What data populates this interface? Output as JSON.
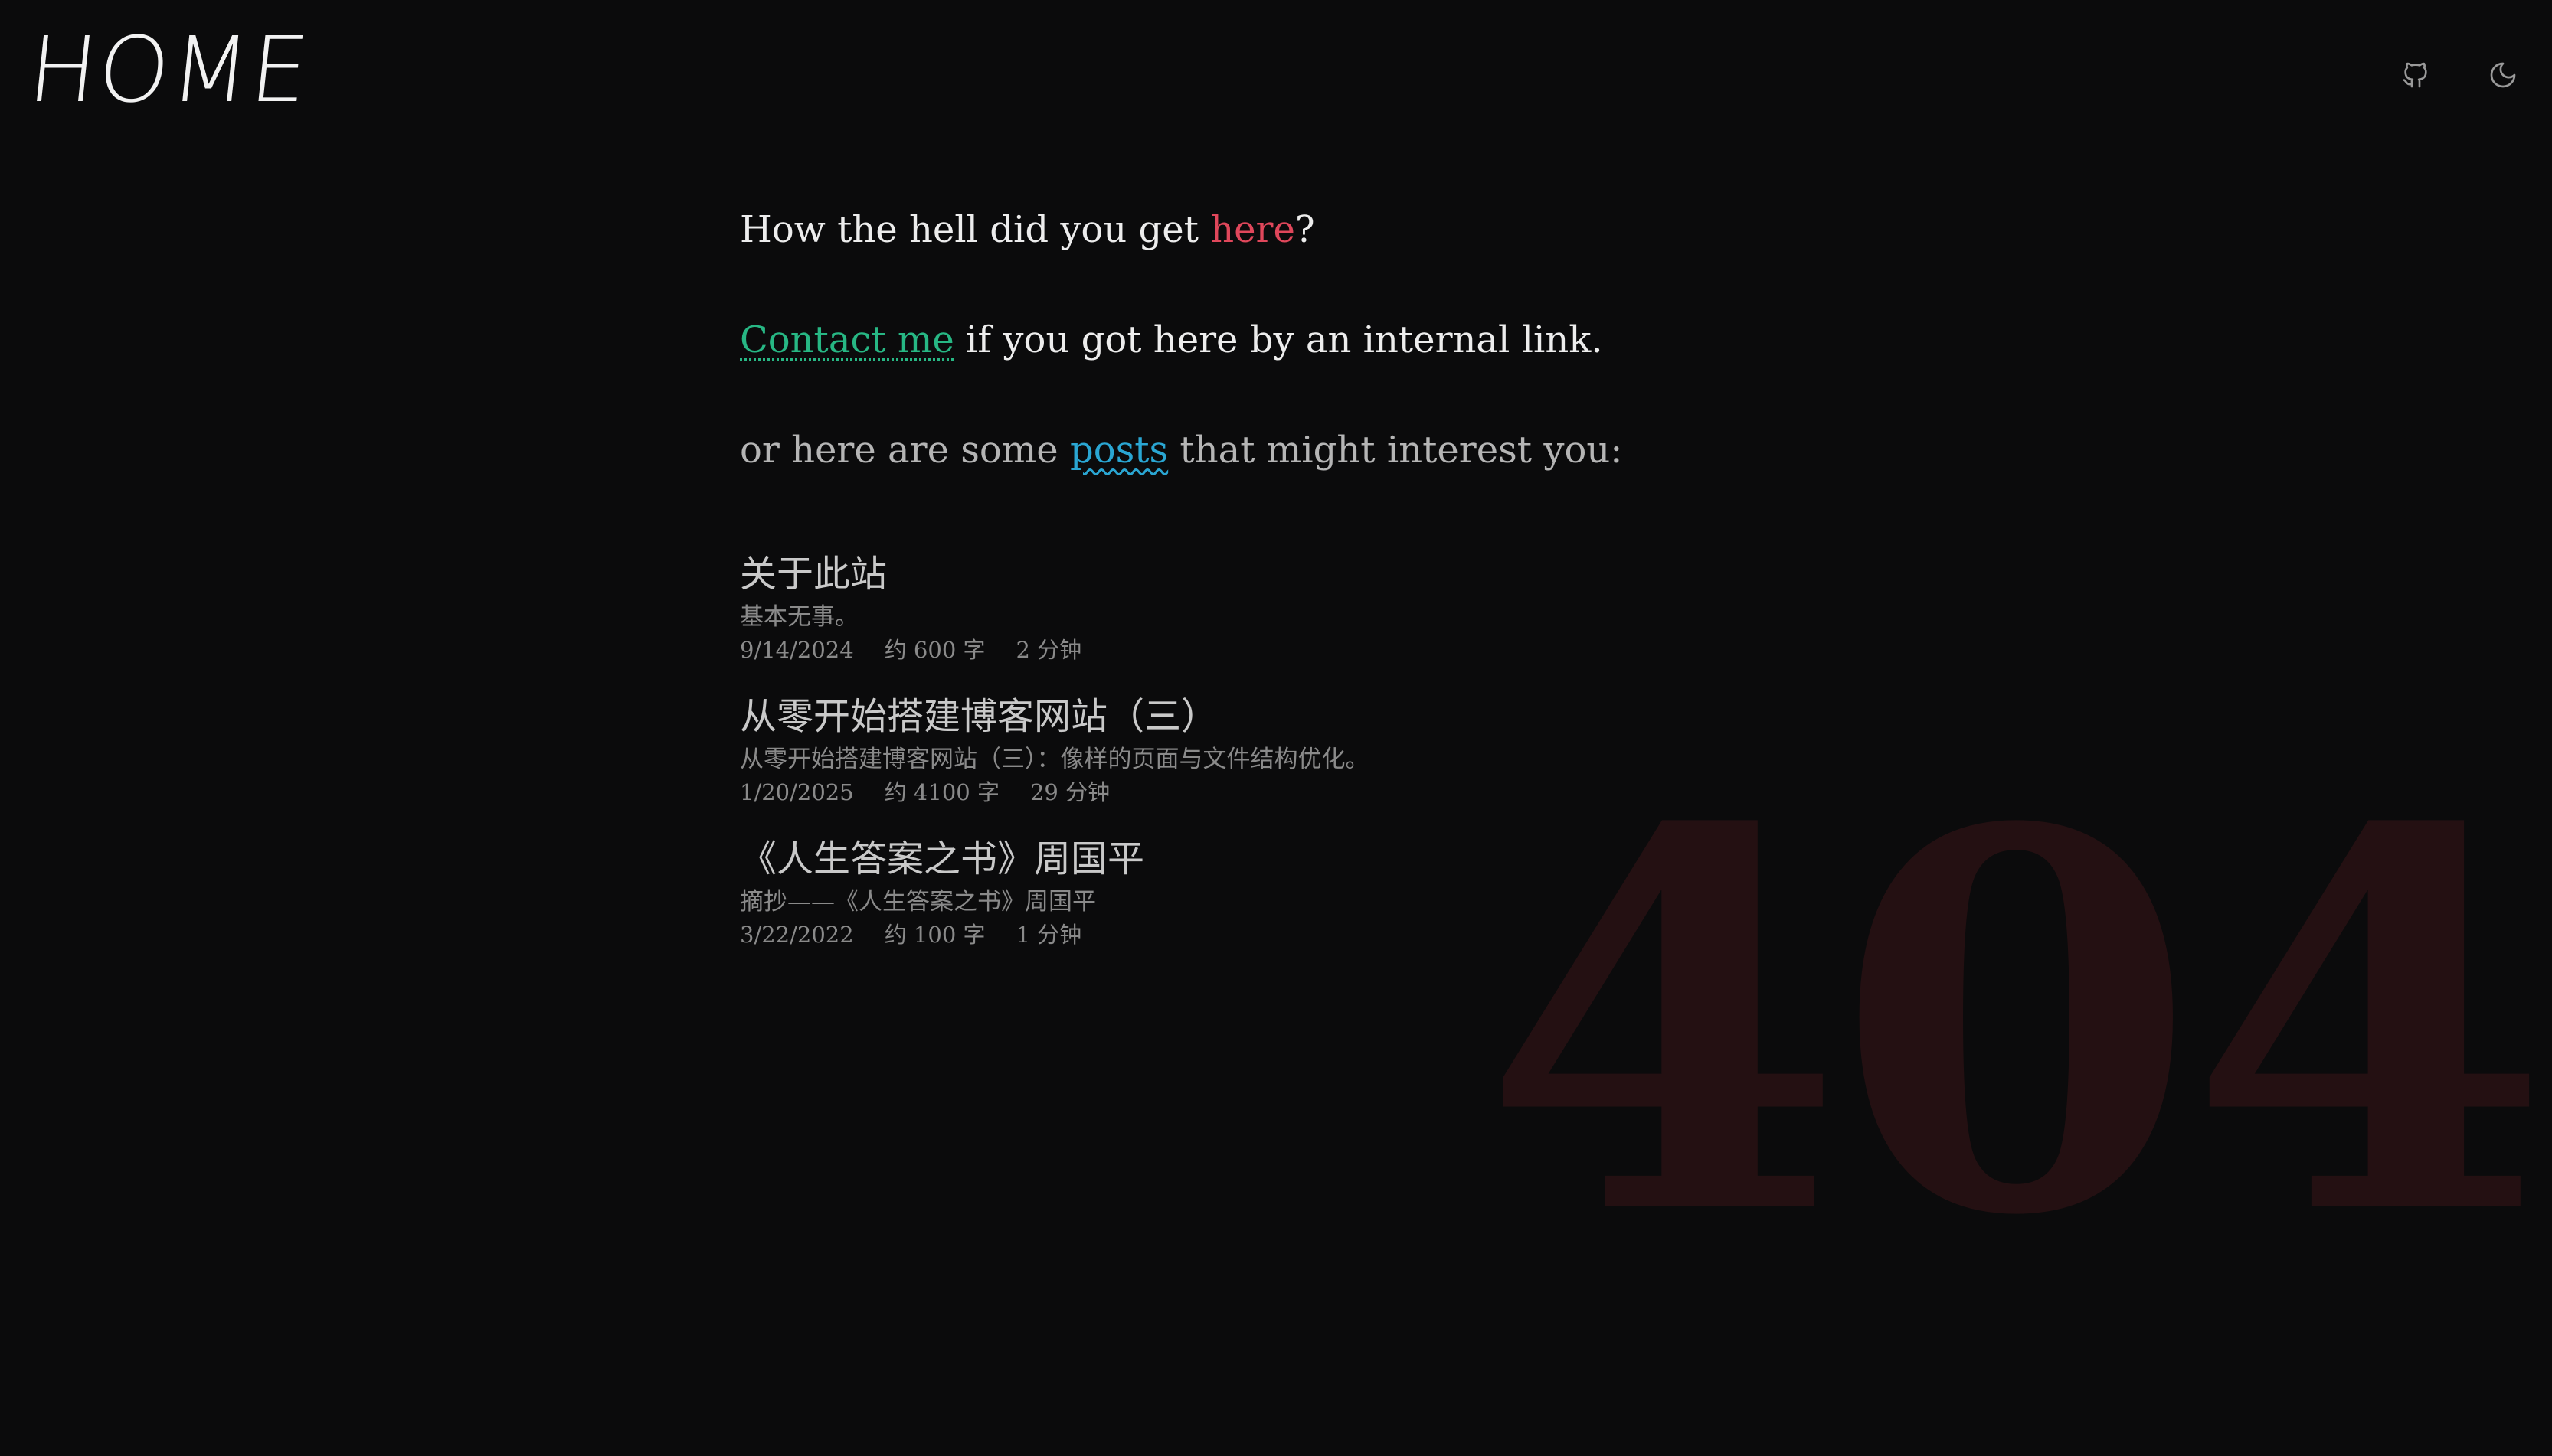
{
  "header": {
    "logo_text": "HOME",
    "icons": [
      "github-icon",
      "moon-icon"
    ]
  },
  "message": {
    "line1_pre": "How the hell did you get ",
    "line1_link": "here",
    "line1_post": "?",
    "line2_link": "Contact me",
    "line2_post": " if you got here by an internal link.",
    "line3_pre": "or here are some ",
    "line3_link": "posts",
    "line3_post": " that might interest you:"
  },
  "posts": [
    {
      "title": "关于此站",
      "description": "基本无事。",
      "date": "9/14/2024",
      "words": "约 600 字",
      "read_time": "2 分钟"
    },
    {
      "title": "从零开始搭建博客网站（三）",
      "description": "从零开始搭建博客网站（三）：像样的页面与文件结构优化。",
      "date": "1/20/2025",
      "words": "约 4100 字",
      "read_time": "29 分钟"
    },
    {
      "title": "《人生答案之书》周国平",
      "description": "摘抄——《人生答案之书》周国平",
      "date": "3/22/2022",
      "words": "约 100 字",
      "read_time": "1 分钟"
    }
  ],
  "background_text": "404",
  "colors": {
    "background": "#0b0b0c",
    "here_link": "#e0475b",
    "contact_link": "#27b784",
    "posts_link": "#2aa6d3",
    "watermark": "#241012"
  }
}
